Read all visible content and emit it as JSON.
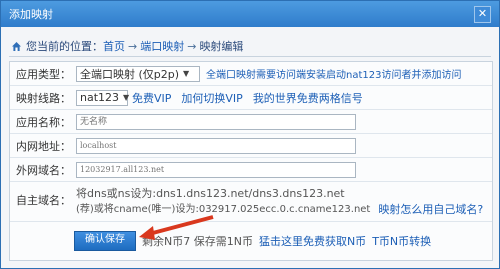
{
  "window": {
    "title": "添加映射",
    "close_label": "✕"
  },
  "breadcrumb": {
    "prefix": "您当前的位置：",
    "home": "首页",
    "sep": "→",
    "parent": "端口映射",
    "current": "映射编辑"
  },
  "fields": {
    "app_type": {
      "label": "应用类型：",
      "value": "全端口映射 (仅p2p)",
      "hint": "全端口映射需要访问端安装启动nat123访问者并添加访问"
    },
    "line": {
      "label": "映射线路：",
      "value": "nat123",
      "links": [
        "免费VIP",
        "加何切换VIP",
        "我的世界免费两格信号"
      ]
    },
    "app_name": {
      "label": "应用名称：",
      "placeholder": "无名称"
    },
    "internal_addr": {
      "label": "内网地址：",
      "placeholder": "localhost"
    },
    "external_domain": {
      "label": "外网域名：",
      "placeholder": "12032917.all123.net"
    },
    "own_domain": {
      "label": "自主域名：",
      "line1": "将dns或ns设为:dns1.dns123.net/dns3.dns123.net",
      "line2": "(荐)或将cname(唯一)设为:032917.025ecc.0.c.cname123.net",
      "link": "映射怎么用自己域名?"
    }
  },
  "footer": {
    "save_label": "确认保存",
    "text": "剩余N币7 保存需1N币",
    "links": [
      "猛击这里免费获取N币",
      "T币N币转换"
    ]
  },
  "colors": {
    "accent": "#2f7ccb",
    "link": "#1d5fb6",
    "arrow": "#d9381e"
  }
}
